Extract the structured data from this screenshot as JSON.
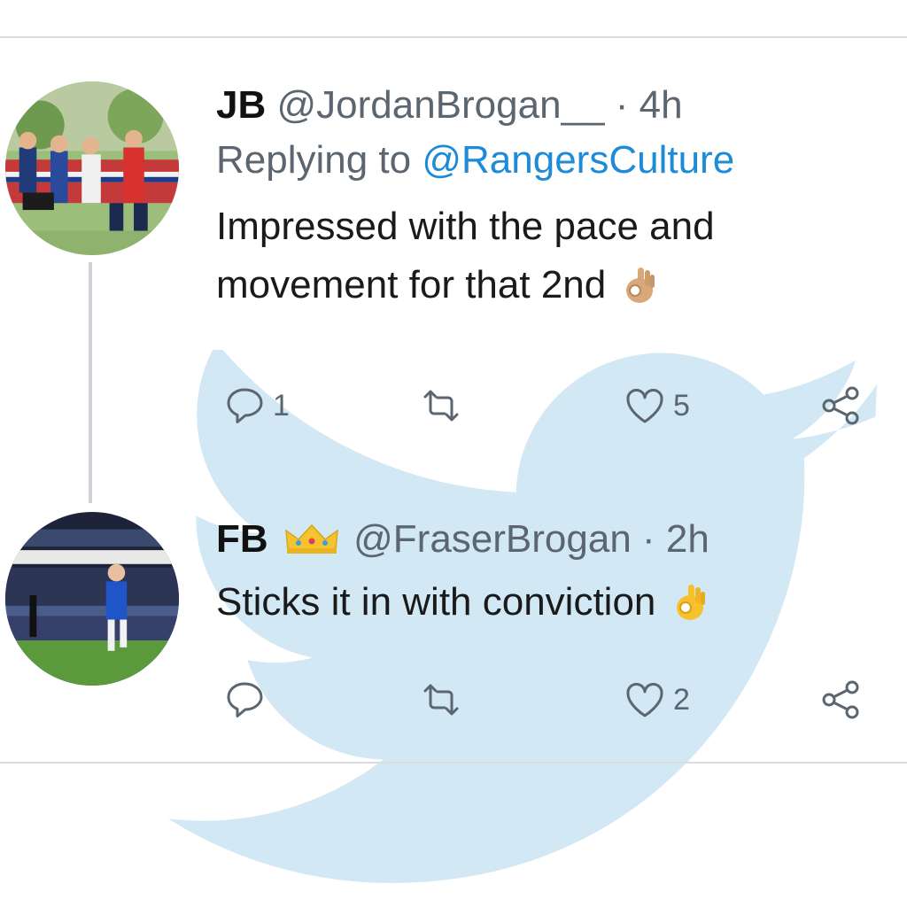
{
  "colors": {
    "link": "#1d8bd8",
    "secondary_text": "#5b6670",
    "watermark": "#d2e8f5"
  },
  "watermark_icon": "twitter-bird-icon",
  "tweets": [
    {
      "name": "JB",
      "handle": "@JordanBrogan__",
      "dot": "·",
      "time": "4h",
      "replying_prefix": "Replying to ",
      "replying_to": "@RangersCulture",
      "text": "Impressed with the pace and movement for that 2nd",
      "emoji": "ok-hand-emoji",
      "actions": {
        "reply_count": "1",
        "retweet_count": "",
        "like_count": "5"
      }
    },
    {
      "name": "FB",
      "badge": "crown-emoji",
      "handle": "@FraserBrogan",
      "dot": "·",
      "time": "2h",
      "text": "Sticks it in with conviction",
      "emoji": "ok-hand-emoji",
      "actions": {
        "reply_count": "",
        "retweet_count": "",
        "like_count": "2"
      }
    }
  ]
}
